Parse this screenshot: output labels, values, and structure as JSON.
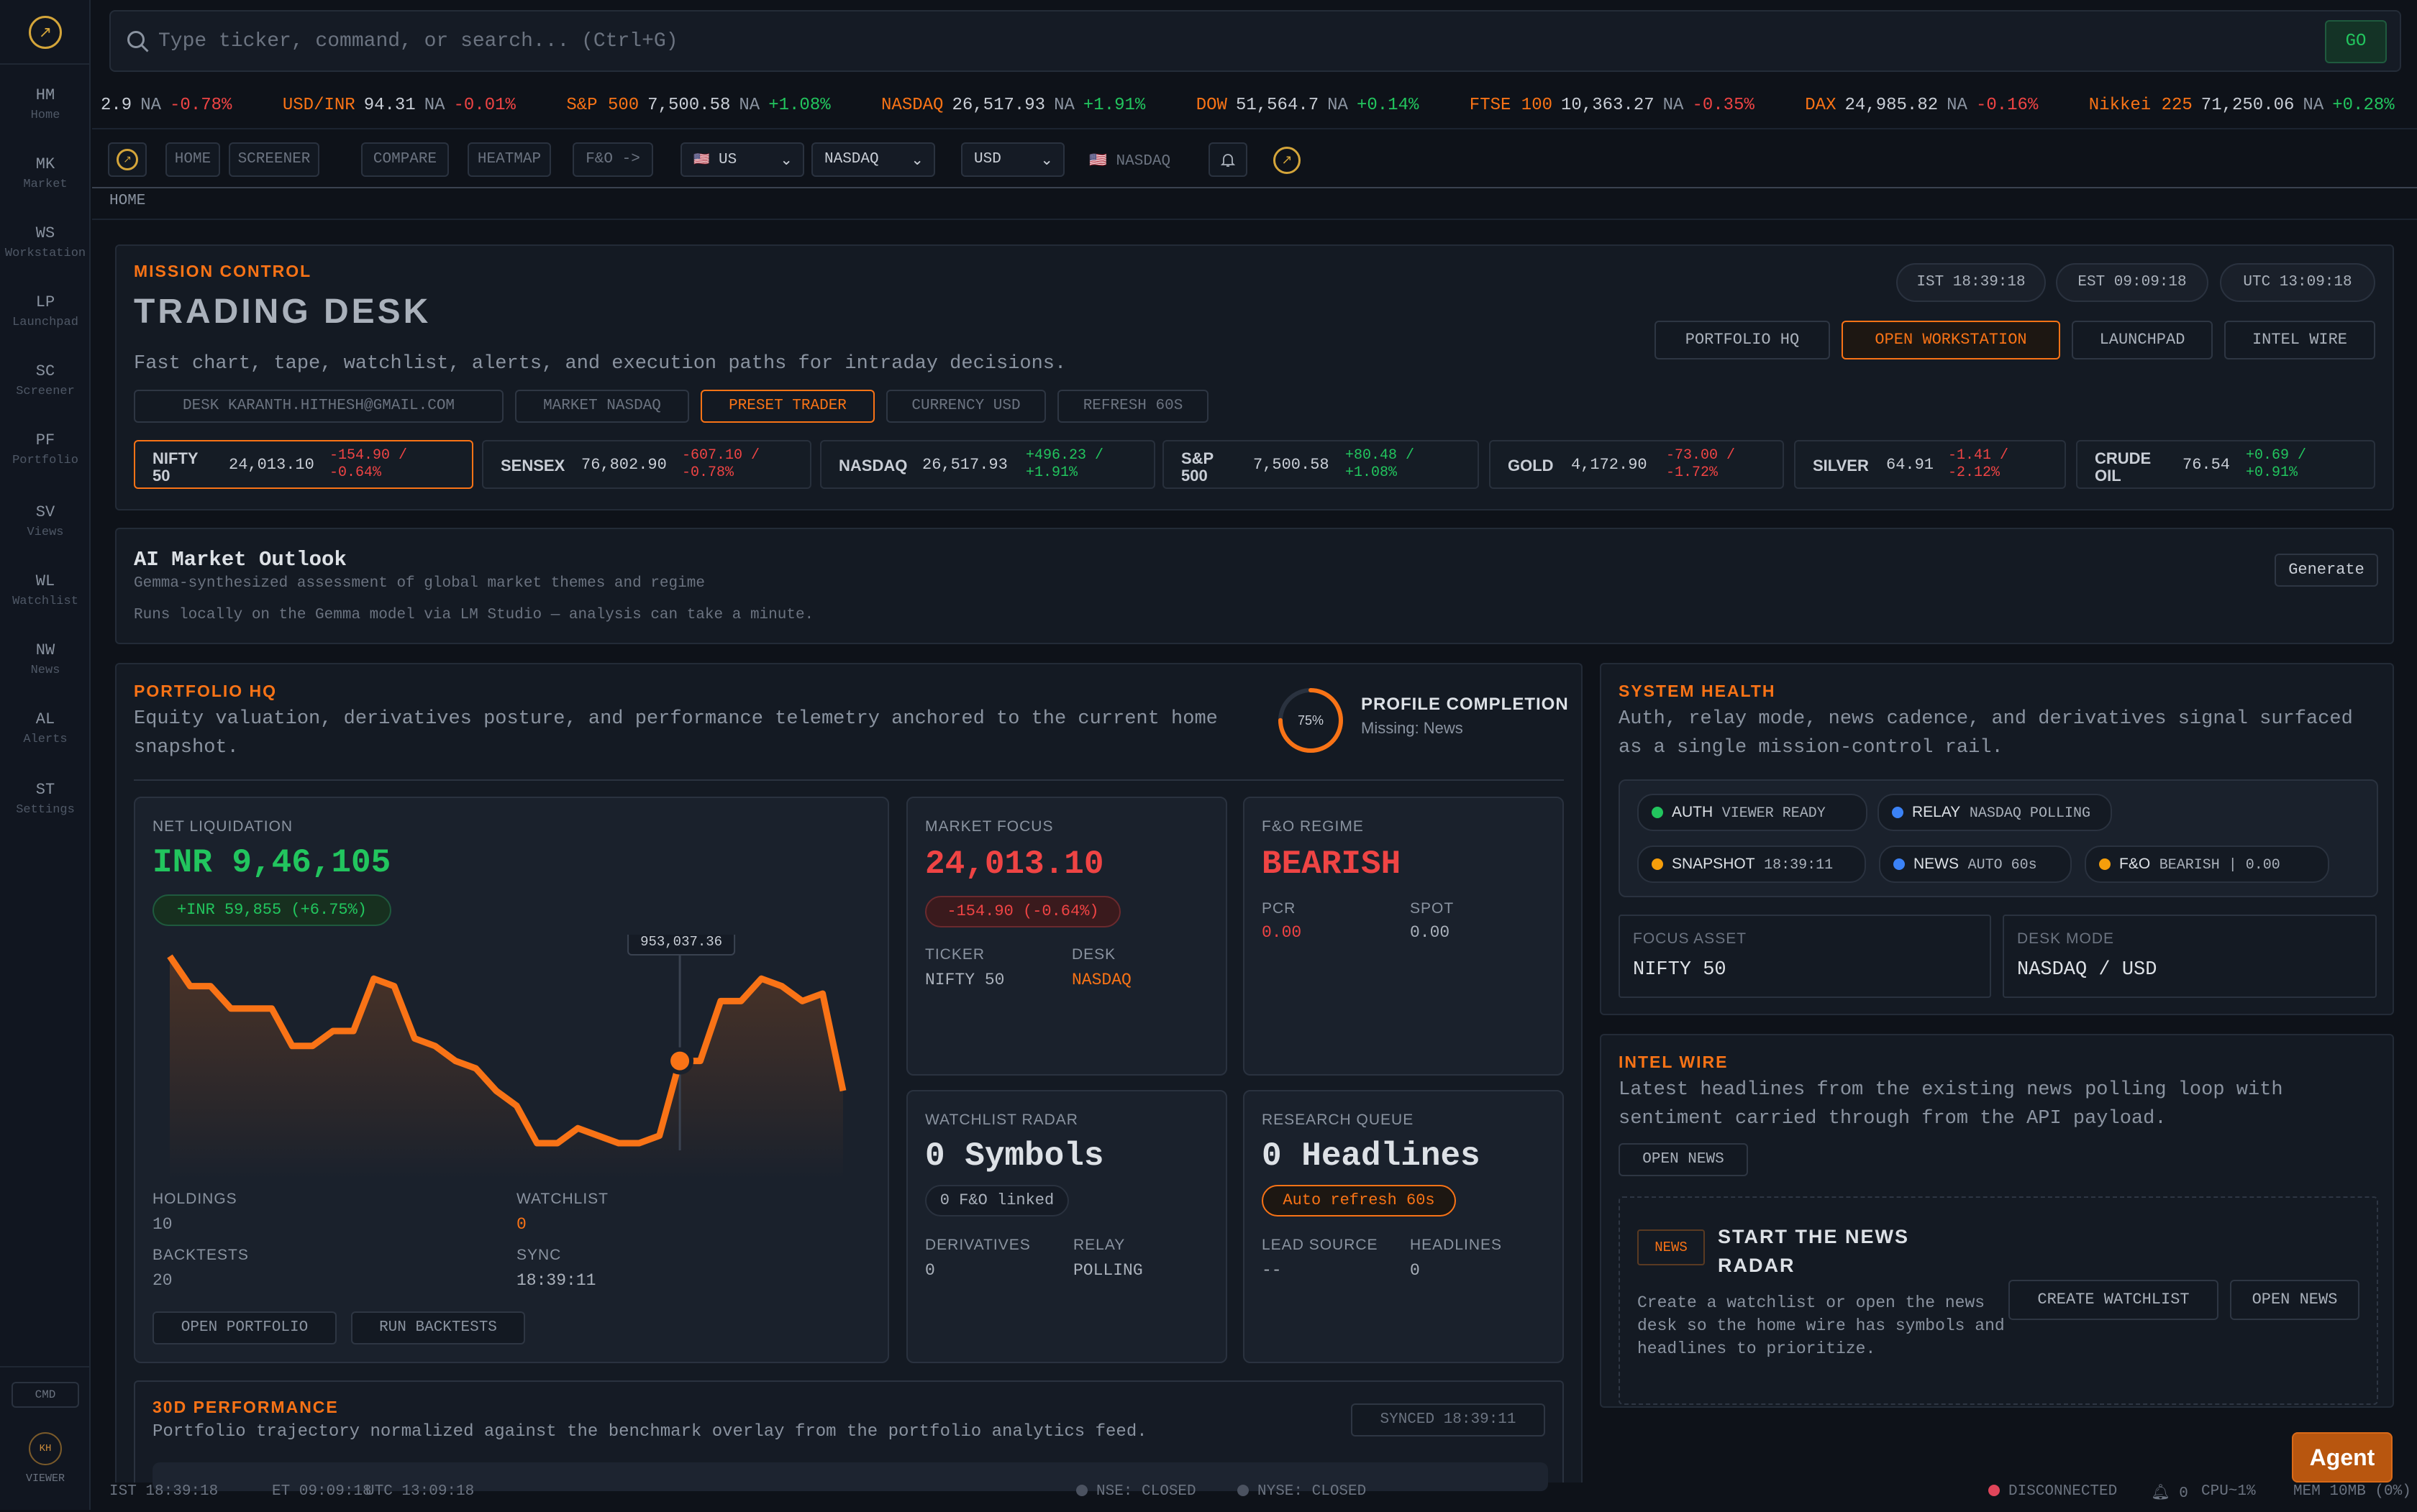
{
  "app": {
    "logo_glyph": "↗"
  },
  "sidebar": {
    "items": [
      {
        "abbr": "HM",
        "label": "Home"
      },
      {
        "abbr": "MK",
        "label": "Market"
      },
      {
        "abbr": "WS",
        "label": "Workstation"
      },
      {
        "abbr": "LP",
        "label": "Launchpad"
      },
      {
        "abbr": "SC",
        "label": "Screener"
      },
      {
        "abbr": "PF",
        "label": "Portfolio"
      },
      {
        "abbr": "SV",
        "label": "Views"
      },
      {
        "abbr": "WL",
        "label": "Watchlist"
      },
      {
        "abbr": "NW",
        "label": "News"
      },
      {
        "abbr": "AL",
        "label": "Alerts"
      },
      {
        "abbr": "ST",
        "label": "Settings"
      }
    ],
    "cmd": "CMD",
    "avatar": "KH",
    "role": "VIEWER"
  },
  "search": {
    "placeholder": "Type ticker, command, or search... (Ctrl+G)",
    "go": "GO"
  },
  "ticker": [
    {
      "name": "",
      "price": "2.9",
      "vol": "NA",
      "chg": "-0.78%"
    },
    {
      "name": "USD/INR",
      "price": "94.31",
      "vol": "NA",
      "chg": "-0.01%"
    },
    {
      "name": "S&P 500",
      "price": "7,500.58",
      "vol": "NA",
      "chg": "+1.08%"
    },
    {
      "name": "NASDAQ",
      "price": "26,517.93",
      "vol": "NA",
      "chg": "+1.91%"
    },
    {
      "name": "DOW",
      "price": "51,564.7",
      "vol": "NA",
      "chg": "+0.14%"
    },
    {
      "name": "FTSE 100",
      "price": "10,363.27",
      "vol": "NA",
      "chg": "-0.35%"
    },
    {
      "name": "DAX",
      "price": "24,985.82",
      "vol": "NA",
      "chg": "-0.16%"
    },
    {
      "name": "Nikkei 225",
      "price": "71,250.06",
      "vol": "NA",
      "chg": "+0.28%"
    },
    {
      "name": "GO",
      "price": "",
      "vol": "",
      "chg": ""
    }
  ],
  "toolbar": {
    "home": "HOME",
    "screener": "SCREENER",
    "compare": "COMPARE",
    "heatmap": "HEATMAP",
    "fno": "F&O ->",
    "flag": "🇺🇸",
    "country": "US",
    "exchange": "NASDAQ",
    "currency": "USD",
    "market_label": "NASDAQ"
  },
  "breadcrumb": "HOME",
  "mission": {
    "eyebrow": "MISSION CONTROL",
    "title": "TRADING DESK",
    "desc": "Fast chart, tape, watchlist, alerts, and execution paths for intraday decisions.",
    "clocks": [
      "IST 18:39:18",
      "EST 09:09:18",
      "UTC 13:09:18"
    ],
    "buttons": [
      "PORTFOLIO HQ",
      "OPEN WORKSTATION",
      "LAUNCHPAD",
      "INTEL WIRE"
    ],
    "chips": [
      "DESK KARANTH.HITHESH@GMAIL.COM",
      "MARKET NASDAQ",
      "PRESET TRADER",
      "CURRENCY USD",
      "REFRESH 60S"
    ],
    "indices": [
      {
        "name1": "NIFTY",
        "name2": "50",
        "price": "24,013.10",
        "c1": "-154.90 /",
        "c2": "-0.64%",
        "dir": "down"
      },
      {
        "name1": "SENSEX",
        "name2": "",
        "price": "76,802.90",
        "c1": "-607.10 /",
        "c2": "-0.78%",
        "dir": "down"
      },
      {
        "name1": "NASDAQ",
        "name2": "",
        "price": "26,517.93",
        "c1": "+496.23 /",
        "c2": "+1.91%",
        "dir": "up"
      },
      {
        "name1": "S&P",
        "name2": "500",
        "price": "7,500.58",
        "c1": "+80.48 /",
        "c2": "+1.08%",
        "dir": "up"
      },
      {
        "name1": "GOLD",
        "name2": "",
        "price": "4,172.90",
        "c1": "-73.00 /",
        "c2": "-1.72%",
        "dir": "down"
      },
      {
        "name1": "SILVER",
        "name2": "",
        "price": "64.91",
        "c1": "-1.41 /",
        "c2": "-2.12%",
        "dir": "down"
      },
      {
        "name1": "CRUDE",
        "name2": "OIL",
        "price": "76.54",
        "c1": "+0.69 /",
        "c2": "+0.91%",
        "dir": "up"
      }
    ]
  },
  "ai": {
    "title": "AI Market Outlook",
    "subtitle": "Gemma-synthesized assessment of global market themes and regime",
    "note": "Runs locally on the Gemma model via LM Studio — analysis can take a minute.",
    "button": "Generate"
  },
  "portfolio": {
    "eyebrow": "PORTFOLIO HQ",
    "desc": "Equity valuation, derivatives posture, and performance telemetry anchored to the current home snapshot.",
    "completion": {
      "pct": "75%",
      "value": 0.75,
      "title": "PROFILE COMPLETION",
      "missing": "Missing: News"
    },
    "net": {
      "label": "NET LIQUIDATION",
      "value": "INR 9,46,105",
      "change": "+INR 59,855 (+6.75%)",
      "tooltip": "953,037.36",
      "holdings_label": "HOLDINGS",
      "holdings": "10",
      "watchlist_label": "WATCHLIST",
      "watchlist": "0",
      "backtests_label": "BACKTESTS",
      "backtests": "20",
      "sync_label": "SYNC",
      "sync": "18:39:11",
      "btn_open": "OPEN PORTFOLIO",
      "btn_run": "RUN BACKTESTS"
    },
    "focus": {
      "label": "MARKET FOCUS",
      "value": "24,013.10",
      "change": "-154.90 (-0.64%)",
      "ticker_label": "TICKER",
      "ticker": "NIFTY 50",
      "desk_label": "DESK",
      "desk": "NASDAQ"
    },
    "fno": {
      "label": "F&O REGIME",
      "value": "BEARISH",
      "pcr_label": "PCR",
      "pcr": "0.00",
      "spot_label": "SPOT",
      "spot": "0.00"
    },
    "watch": {
      "label": "WATCHLIST RADAR",
      "value": "0 Symbols",
      "pill": "0 F&O linked",
      "der_label": "DERIVATIVES",
      "der": "0",
      "relay_label": "RELAY",
      "relay": "POLLING"
    },
    "research": {
      "label": "RESEARCH QUEUE",
      "value": "0 Headlines",
      "pill": "Auto refresh 60s",
      "lead_label": "LEAD SOURCE",
      "lead": "--",
      "head_label": "HEADLINES",
      "head": "0"
    },
    "perf": {
      "title": "30D PERFORMANCE",
      "desc": "Portfolio trajectory normalized against the benchmark overlay from the portfolio analytics feed.",
      "synced": "SYNCED 18:39:11"
    }
  },
  "chart_data": {
    "type": "line",
    "series": [
      {
        "values": [
          100,
          96,
          96,
          93,
          93,
          93,
          88,
          88,
          90,
          90,
          97,
          96,
          89,
          88,
          86,
          85,
          82,
          80,
          75,
          75,
          77,
          76,
          75,
          75,
          76,
          86,
          86,
          94,
          94,
          97,
          96,
          94,
          95,
          82
        ]
      }
    ],
    "highlight_index": 25,
    "highlight_label": "953,037.36",
    "color": "#f97316"
  },
  "health": {
    "eyebrow": "SYSTEM HEALTH",
    "desc": "Auth, relay mode, news cadence, and derivatives signal surfaced as a single mission-control rail.",
    "pills": [
      {
        "name": "AUTH",
        "value": "VIEWER READY",
        "color": "#22c55e"
      },
      {
        "name": "RELAY",
        "value": "NASDAQ POLLING",
        "color": "#3b82f6"
      },
      {
        "name": "SNAPSHOT",
        "value": "18:39:11",
        "color": "#f59e0b"
      },
      {
        "name": "NEWS",
        "value": "AUTO 60s",
        "color": "#3b82f6"
      },
      {
        "name": "F&O",
        "value": "BEARISH | 0.00",
        "color": "#f59e0b"
      }
    ],
    "focus_label": "FOCUS ASSET",
    "focus": "NIFTY 50",
    "mode_label": "DESK MODE",
    "mode": "NASDAQ / USD"
  },
  "intel": {
    "eyebrow": "INTEL WIRE",
    "desc": "Latest headlines from the existing news polling loop with sentiment carried through from the API payload.",
    "open": "OPEN NEWS",
    "badge": "NEWS",
    "empty_title": "START THE NEWS RADAR",
    "empty_desc": "Create a watchlist or open the news desk so the home wire has symbols and headlines to prioritize.",
    "btn_create": "CREATE WATCHLIST",
    "btn_open": "OPEN NEWS"
  },
  "status": {
    "ist": "IST 18:39:18",
    "et": "ET 09:09:18",
    "utc": "UTC 13:09:18",
    "nse": "NSE: CLOSED",
    "nyse": "NYSE: CLOSED",
    "conn": "DISCONNECTED",
    "alerts": "0",
    "cpu": "CPU~1%",
    "mem": "MEM 10MB (0%)"
  },
  "agent": "Agent"
}
